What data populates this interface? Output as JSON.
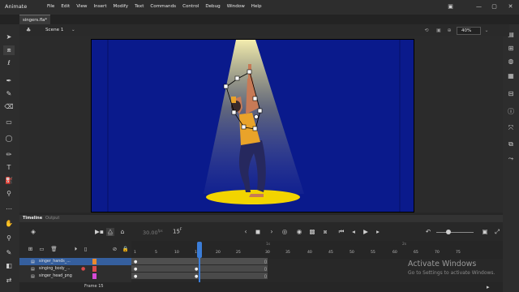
{
  "app": {
    "logo": "Animate"
  },
  "menu": [
    "File",
    "Edit",
    "View",
    "Insert",
    "Modify",
    "Text",
    "Commands",
    "Control",
    "Debug",
    "Window",
    "Help"
  ],
  "window_controls": {
    "minimize": "—",
    "maximize": "▢",
    "close": "✕"
  },
  "document": {
    "tab_label": "singers.fla*"
  },
  "scene": {
    "label": "Scene 1",
    "zoom": "40%"
  },
  "timeline": {
    "title": "Timeline",
    "output_tab": "Output",
    "fps": "30.00",
    "fps_unit": "fps",
    "current_frame": "15",
    "frame_unit": "F",
    "layers": [
      {
        "name": "singer_hands_...",
        "color": "#e98a2e",
        "selected": true
      },
      {
        "name": "singing_body_...",
        "color": "#d94a4a",
        "selected": false
      },
      {
        "name": "singer_head_png",
        "color": "#d64ad6",
        "selected": false
      }
    ],
    "ruler_numbers": [
      "1",
      "5",
      "10",
      "15",
      "20",
      "25",
      "30",
      "35",
      "40",
      "45",
      "50",
      "55",
      "60",
      "65",
      "70",
      "75"
    ],
    "second_marks": [
      "1s",
      "2s"
    ],
    "frame_label": "Frame",
    "frame_label_value": "15"
  },
  "watermark": {
    "title": "Activate Windows",
    "subtitle": "Go to Settings to activate Windows."
  },
  "colors": {
    "stage": "#0a1a8c",
    "spotlight": "#f2d400",
    "playhead": "#3b7dd8"
  }
}
